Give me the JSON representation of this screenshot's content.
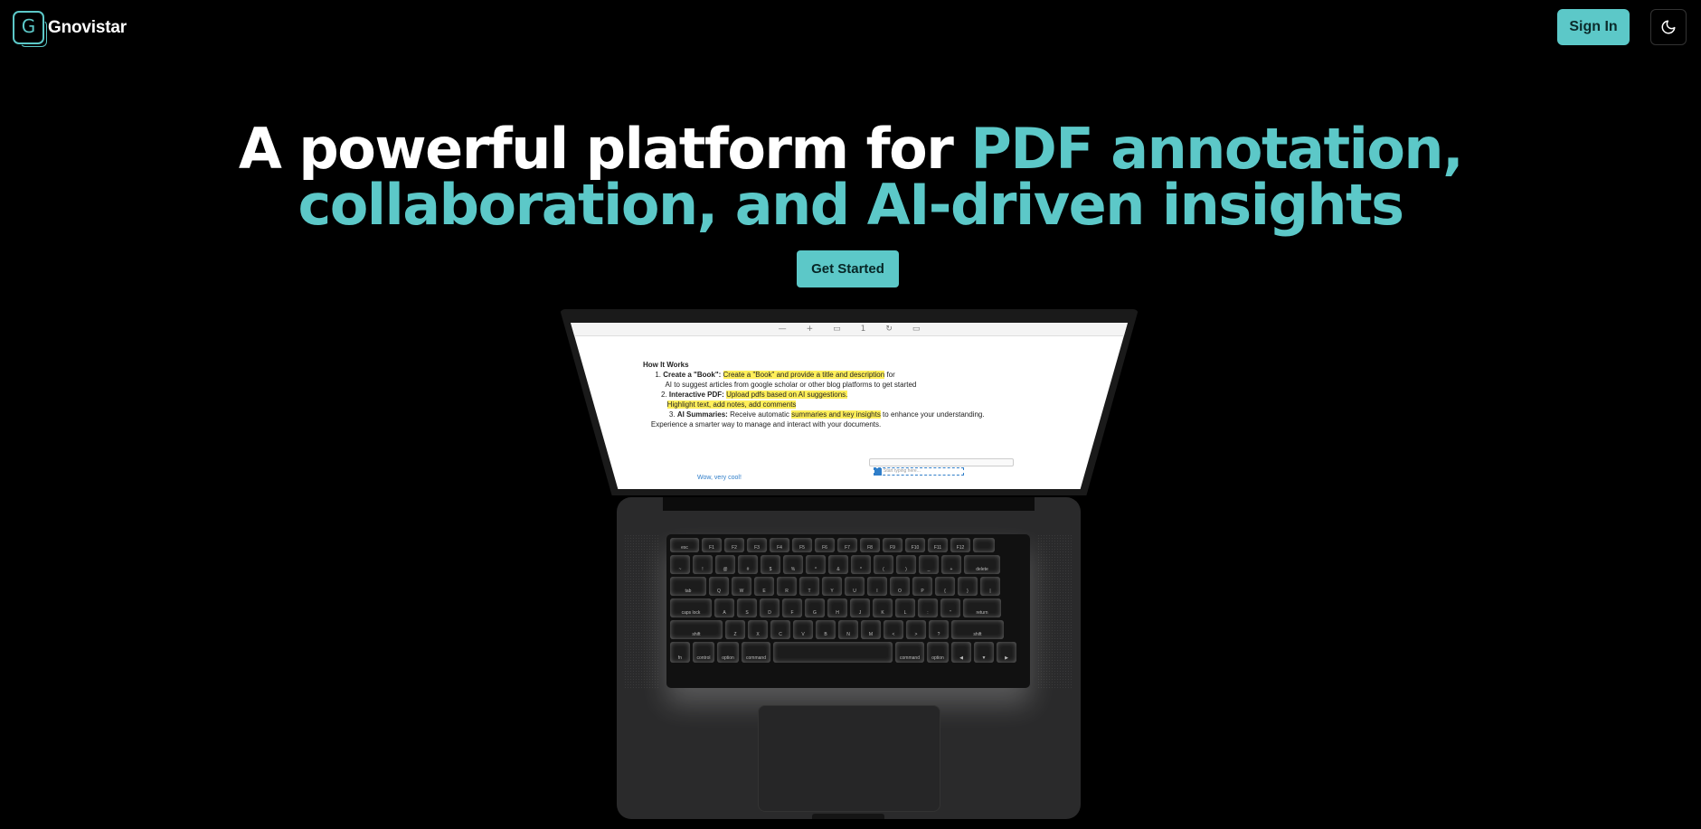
{
  "header": {
    "logo_letter": "G",
    "brand": "Gnovistar",
    "signin_label": "Sign In",
    "theme_icon": "moon-icon"
  },
  "hero": {
    "line1_white": "A powerful platform for ",
    "line1_teal": "PDF annotation,",
    "line2_teal": "collaboration, and AI-driven insights",
    "cta_label": "Get Started"
  },
  "colors": {
    "accent": "#5cc8c8",
    "background": "#000000"
  },
  "preview": {
    "heading": "How It Works",
    "items": [
      {
        "num": "1.",
        "bold": "Create a \"Book\":",
        "hl": "Create a \"Book\" and provide a title and description",
        "rest": " for"
      },
      {
        "num": "",
        "bold": "",
        "hl": "",
        "rest": "AI to suggest articles from google scholar or other blog platforms to get started"
      },
      {
        "num": "2.",
        "bold": "Interactive PDF:",
        "hl": "Upload pdfs based on AI suggestions.",
        "rest": ""
      },
      {
        "num": "",
        "bold": "",
        "hl": "Highlight text, add notes, add comments",
        "rest": ""
      },
      {
        "num": "3.",
        "bold": "AI Summaries:",
        "hl": "summaries and key insights",
        "pre": "Receive automatic ",
        "rest": " to enhance your understanding."
      }
    ],
    "closing": "Experience a smarter way to manage and interact with your documents.",
    "link": "Wow, very cool!",
    "input_placeholder": "Start typing here..."
  },
  "keyboard": {
    "rows": [
      [
        "esc",
        "F1",
        "F2",
        "F3",
        "F4",
        "F5",
        "F6",
        "F7",
        "F8",
        "F9",
        "F10",
        "F11",
        "F12",
        ""
      ],
      [
        "~",
        "!",
        "@",
        "#",
        "$",
        "%",
        "^",
        "&",
        "*",
        "(",
        ")",
        "_",
        "+",
        "delete"
      ],
      [
        "tab",
        "Q",
        "W",
        "E",
        "R",
        "T",
        "Y",
        "U",
        "I",
        "O",
        "P",
        "{",
        "}",
        "|"
      ],
      [
        "caps lock",
        "A",
        "S",
        "D",
        "F",
        "G",
        "H",
        "J",
        "K",
        "L",
        ":",
        "\"",
        "return"
      ],
      [
        "shift",
        "Z",
        "X",
        "C",
        "V",
        "B",
        "N",
        "M",
        "<",
        ">",
        "?",
        "shift"
      ],
      [
        "fn",
        "control",
        "option",
        "command",
        "",
        "command",
        "option",
        "◀",
        "▼",
        "▶"
      ]
    ]
  }
}
